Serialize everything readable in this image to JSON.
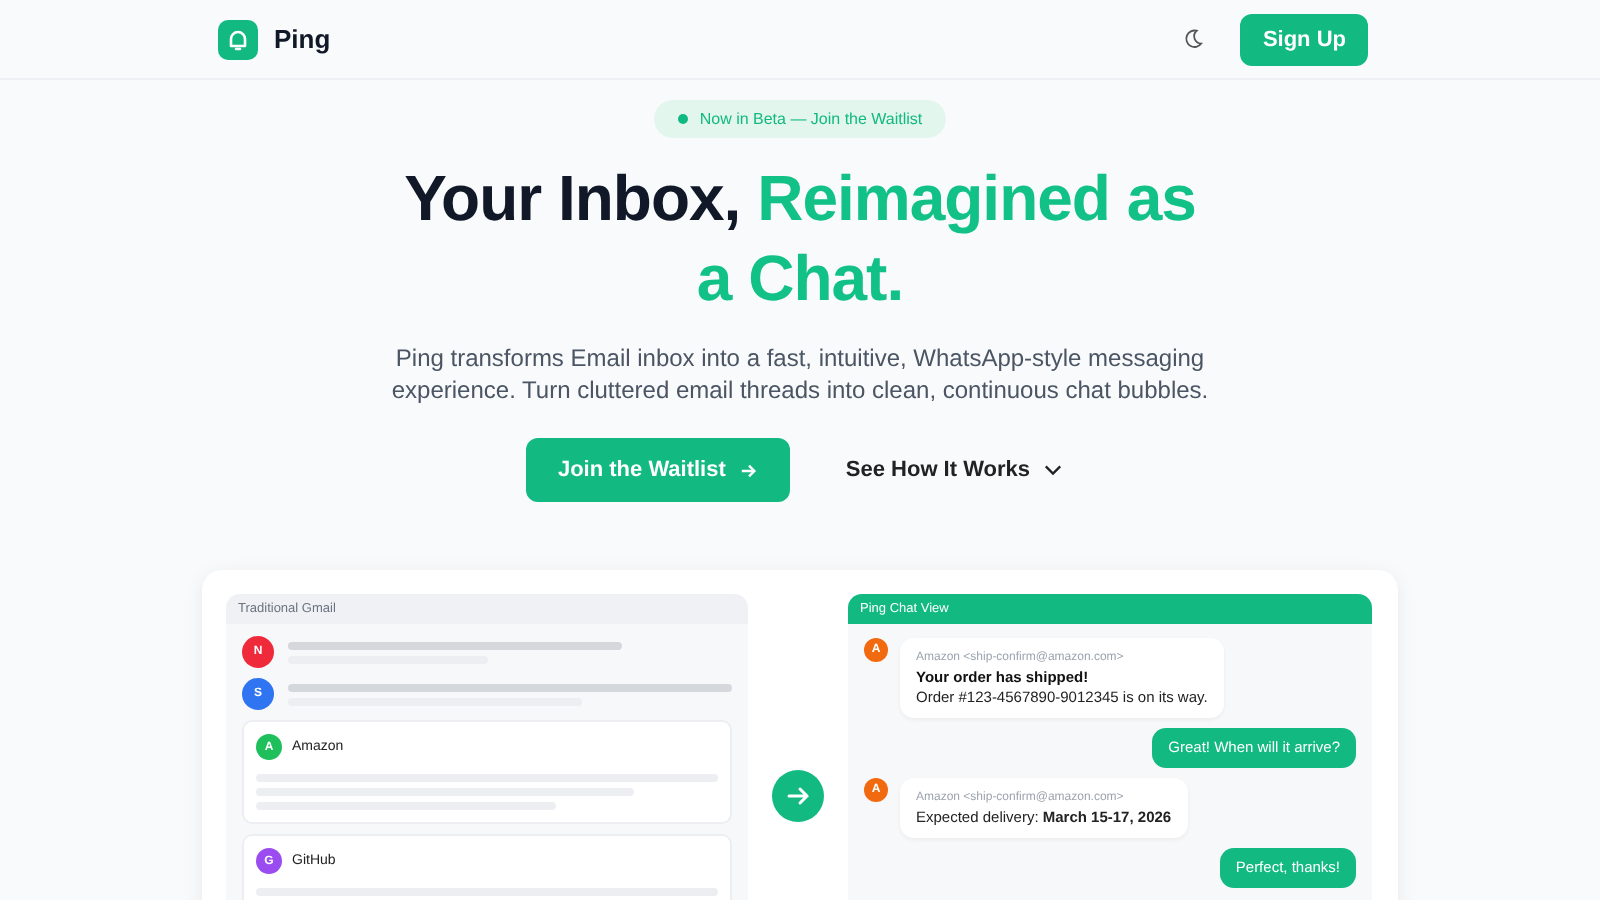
{
  "header": {
    "brand": "Ping",
    "action": "Sign Up"
  },
  "badge": "Now in Beta — Join the Waitlist",
  "hero": {
    "title": [
      {
        "text": "Your Inbox, ",
        "accent": false
      },
      {
        "text": "Reimagined as a Chat.",
        "accent": true
      }
    ],
    "description": "Ping transforms Email inbox into a fast, intuitive, WhatsApp-style messaging experience. Turn cluttered email threads into clean, continuous chat bubbles.",
    "primary": "Join the Waitlist",
    "secondary": "See How It Works"
  },
  "gmail": {
    "title": "Traditional Gmail",
    "items": [
      {
        "kind": "row",
        "initial": "N",
        "color": "#ef2b3b"
      },
      {
        "kind": "row",
        "initial": "S",
        "color": "#2f74f0"
      },
      {
        "kind": "card",
        "initial": "A",
        "color": "#1fbf5c",
        "name": "Amazon"
      },
      {
        "kind": "card",
        "initial": "G",
        "color": "#9b4cf0",
        "name": "GitHub"
      }
    ]
  },
  "chat": {
    "title": "Ping Chat View",
    "messages": [
      {
        "kind": "incoming",
        "initial": "A",
        "sender": "Amazon <ship-confirm@amazon.com>",
        "title": "Your order has shipped!",
        "body": "Order #123-4567890-9012345 is on its way."
      },
      {
        "kind": "outgoing",
        "body": "Great! When will it arrive?"
      },
      {
        "kind": "incoming",
        "initial": "A",
        "sender": "Amazon <ship-confirm@amazon.com>",
        "body": "Expected delivery: **March 15-17, 2026**"
      },
      {
        "kind": "outgoing",
        "body": "Perfect, thanks!"
      }
    ]
  }
}
